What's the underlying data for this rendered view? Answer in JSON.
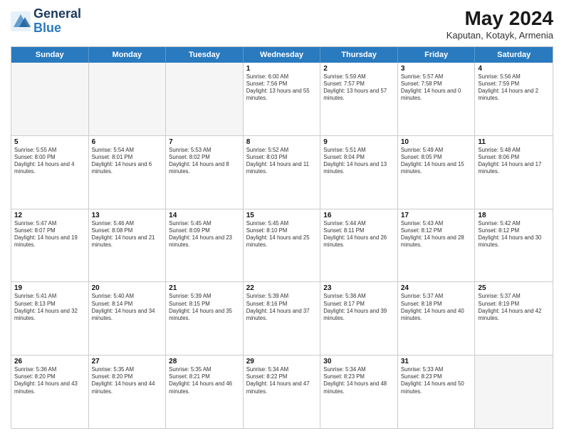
{
  "header": {
    "logo_line1": "General",
    "logo_line2": "Blue",
    "month_title": "May 2024",
    "location": "Kaputan, Kotayk, Armenia"
  },
  "days_of_week": [
    "Sunday",
    "Monday",
    "Tuesday",
    "Wednesday",
    "Thursday",
    "Friday",
    "Saturday"
  ],
  "rows": [
    [
      {
        "day": "",
        "empty": true
      },
      {
        "day": "",
        "empty": true
      },
      {
        "day": "",
        "empty": true
      },
      {
        "day": "1",
        "sunrise": "Sunrise: 6:00 AM",
        "sunset": "Sunset: 7:56 PM",
        "daylight": "Daylight: 13 hours and 55 minutes."
      },
      {
        "day": "2",
        "sunrise": "Sunrise: 5:59 AM",
        "sunset": "Sunset: 7:57 PM",
        "daylight": "Daylight: 13 hours and 57 minutes."
      },
      {
        "day": "3",
        "sunrise": "Sunrise: 5:57 AM",
        "sunset": "Sunset: 7:58 PM",
        "daylight": "Daylight: 14 hours and 0 minutes."
      },
      {
        "day": "4",
        "sunrise": "Sunrise: 5:56 AM",
        "sunset": "Sunset: 7:59 PM",
        "daylight": "Daylight: 14 hours and 2 minutes."
      }
    ],
    [
      {
        "day": "5",
        "sunrise": "Sunrise: 5:55 AM",
        "sunset": "Sunset: 8:00 PM",
        "daylight": "Daylight: 14 hours and 4 minutes."
      },
      {
        "day": "6",
        "sunrise": "Sunrise: 5:54 AM",
        "sunset": "Sunset: 8:01 PM",
        "daylight": "Daylight: 14 hours and 6 minutes."
      },
      {
        "day": "7",
        "sunrise": "Sunrise: 5:53 AM",
        "sunset": "Sunset: 8:02 PM",
        "daylight": "Daylight: 14 hours and 8 minutes."
      },
      {
        "day": "8",
        "sunrise": "Sunrise: 5:52 AM",
        "sunset": "Sunset: 8:03 PM",
        "daylight": "Daylight: 14 hours and 11 minutes."
      },
      {
        "day": "9",
        "sunrise": "Sunrise: 5:51 AM",
        "sunset": "Sunset: 8:04 PM",
        "daylight": "Daylight: 14 hours and 13 minutes."
      },
      {
        "day": "10",
        "sunrise": "Sunrise: 5:49 AM",
        "sunset": "Sunset: 8:05 PM",
        "daylight": "Daylight: 14 hours and 15 minutes."
      },
      {
        "day": "11",
        "sunrise": "Sunrise: 5:48 AM",
        "sunset": "Sunset: 8:06 PM",
        "daylight": "Daylight: 14 hours and 17 minutes."
      }
    ],
    [
      {
        "day": "12",
        "sunrise": "Sunrise: 5:47 AM",
        "sunset": "Sunset: 8:07 PM",
        "daylight": "Daylight: 14 hours and 19 minutes."
      },
      {
        "day": "13",
        "sunrise": "Sunrise: 5:46 AM",
        "sunset": "Sunset: 8:08 PM",
        "daylight": "Daylight: 14 hours and 21 minutes."
      },
      {
        "day": "14",
        "sunrise": "Sunrise: 5:45 AM",
        "sunset": "Sunset: 8:09 PM",
        "daylight": "Daylight: 14 hours and 23 minutes."
      },
      {
        "day": "15",
        "sunrise": "Sunrise: 5:45 AM",
        "sunset": "Sunset: 8:10 PM",
        "daylight": "Daylight: 14 hours and 25 minutes."
      },
      {
        "day": "16",
        "sunrise": "Sunrise: 5:44 AM",
        "sunset": "Sunset: 8:11 PM",
        "daylight": "Daylight: 14 hours and 26 minutes."
      },
      {
        "day": "17",
        "sunrise": "Sunrise: 5:43 AM",
        "sunset": "Sunset: 8:12 PM",
        "daylight": "Daylight: 14 hours and 28 minutes."
      },
      {
        "day": "18",
        "sunrise": "Sunrise: 5:42 AM",
        "sunset": "Sunset: 8:12 PM",
        "daylight": "Daylight: 14 hours and 30 minutes."
      }
    ],
    [
      {
        "day": "19",
        "sunrise": "Sunrise: 5:41 AM",
        "sunset": "Sunset: 8:13 PM",
        "daylight": "Daylight: 14 hours and 32 minutes."
      },
      {
        "day": "20",
        "sunrise": "Sunrise: 5:40 AM",
        "sunset": "Sunset: 8:14 PM",
        "daylight": "Daylight: 14 hours and 34 minutes."
      },
      {
        "day": "21",
        "sunrise": "Sunrise: 5:39 AM",
        "sunset": "Sunset: 8:15 PM",
        "daylight": "Daylight: 14 hours and 35 minutes."
      },
      {
        "day": "22",
        "sunrise": "Sunrise: 5:39 AM",
        "sunset": "Sunset: 8:16 PM",
        "daylight": "Daylight: 14 hours and 37 minutes."
      },
      {
        "day": "23",
        "sunrise": "Sunrise: 5:38 AM",
        "sunset": "Sunset: 8:17 PM",
        "daylight": "Daylight: 14 hours and 39 minutes."
      },
      {
        "day": "24",
        "sunrise": "Sunrise: 5:37 AM",
        "sunset": "Sunset: 8:18 PM",
        "daylight": "Daylight: 14 hours and 40 minutes."
      },
      {
        "day": "25",
        "sunrise": "Sunrise: 5:37 AM",
        "sunset": "Sunset: 8:19 PM",
        "daylight": "Daylight: 14 hours and 42 minutes."
      }
    ],
    [
      {
        "day": "26",
        "sunrise": "Sunrise: 5:36 AM",
        "sunset": "Sunset: 8:20 PM",
        "daylight": "Daylight: 14 hours and 43 minutes."
      },
      {
        "day": "27",
        "sunrise": "Sunrise: 5:35 AM",
        "sunset": "Sunset: 8:20 PM",
        "daylight": "Daylight: 14 hours and 44 minutes."
      },
      {
        "day": "28",
        "sunrise": "Sunrise: 5:35 AM",
        "sunset": "Sunset: 8:21 PM",
        "daylight": "Daylight: 14 hours and 46 minutes."
      },
      {
        "day": "29",
        "sunrise": "Sunrise: 5:34 AM",
        "sunset": "Sunset: 8:22 PM",
        "daylight": "Daylight: 14 hours and 47 minutes."
      },
      {
        "day": "30",
        "sunrise": "Sunrise: 5:34 AM",
        "sunset": "Sunset: 8:23 PM",
        "daylight": "Daylight: 14 hours and 48 minutes."
      },
      {
        "day": "31",
        "sunrise": "Sunrise: 5:33 AM",
        "sunset": "Sunset: 8:23 PM",
        "daylight": "Daylight: 14 hours and 50 minutes."
      },
      {
        "day": "",
        "empty": true
      }
    ]
  ]
}
